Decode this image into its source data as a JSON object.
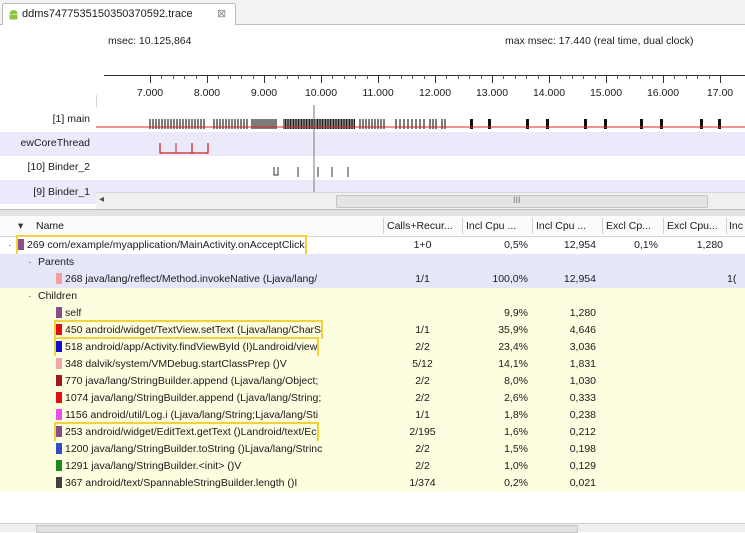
{
  "tab": {
    "title": "ddms7477535150350370592.trace",
    "close": "⊠"
  },
  "timeline": {
    "msec_label": "msec: 10.125,864",
    "max_label": "max msec: 17.440 (real time, dual clock)",
    "ticks": [
      "7.000",
      "8.000",
      "9.000",
      "10.000",
      "11.000",
      "12.000",
      "13.000",
      "14.000",
      "15.000",
      "16.000",
      "17.00"
    ],
    "threads": [
      "[1] main",
      "ewCoreThread",
      "[10] Binder_2",
      "[9] Binder_1"
    ],
    "scroll_left": "◂",
    "scroll_grip": "III"
  },
  "table": {
    "columns": [
      "Name",
      "Calls+Recur...",
      "Incl Cpu ...",
      "Incl Cpu ...",
      "Excl Cp...",
      "Excl Cpu...",
      "Inc"
    ],
    "sort_arrow": "▾",
    "rows": [
      {
        "id": "r0",
        "indent": 0,
        "expand": "·",
        "color": "#8a4d8a",
        "name": "269 com/example/myapplication/MainActivity.onAcceptClick",
        "calls": "1+0",
        "incl_pct": "0,5%",
        "incl": "12,954",
        "excl_pct": "0,1%",
        "excl": "1,280",
        "extra": "",
        "hl": true,
        "bg": "#ffffff"
      },
      {
        "id": "r1",
        "indent": 1,
        "expand": "·",
        "color": "",
        "name": "Parents",
        "calls": "",
        "incl_pct": "",
        "incl": "",
        "excl_pct": "",
        "excl": "",
        "extra": "",
        "hl": false,
        "bg": "#e6e6fa"
      },
      {
        "id": "r2",
        "indent": 2,
        "expand": "",
        "color": "#f2a0a0",
        "name": "268 java/lang/reflect/Method.invokeNative (Ljava/lang/",
        "calls": "1/1",
        "incl_pct": "100,0%",
        "incl": "12,954",
        "excl_pct": "",
        "excl": "",
        "extra": "1(",
        "hl": false,
        "bg": "#e6e6fa"
      },
      {
        "id": "r3",
        "indent": 1,
        "expand": "·",
        "color": "",
        "name": "Children",
        "calls": "",
        "incl_pct": "",
        "incl": "",
        "excl_pct": "",
        "excl": "",
        "extra": "",
        "hl": false,
        "bg": "#fdfde0"
      },
      {
        "id": "r4",
        "indent": 2,
        "expand": "",
        "color": "#8a4d8a",
        "name": "self",
        "calls": "",
        "incl_pct": "9,9%",
        "incl": "1,280",
        "excl_pct": "",
        "excl": "",
        "extra": "",
        "hl": false,
        "bg": "#fdfde0"
      },
      {
        "id": "r5",
        "indent": 2,
        "expand": "",
        "color": "#e01010",
        "name": "450 android/widget/TextView.setText (Ljava/lang/CharS",
        "calls": "1/1",
        "incl_pct": "35,9%",
        "incl": "4,646",
        "excl_pct": "",
        "excl": "",
        "extra": "",
        "hl": true,
        "bg": "#fdfde0"
      },
      {
        "id": "r6",
        "indent": 2,
        "expand": "",
        "color": "#1010c8",
        "name": "518 android/app/Activity.findViewById (I)Landroid/view",
        "calls": "2/2",
        "incl_pct": "23,4%",
        "incl": "3,036",
        "excl_pct": "",
        "excl": "",
        "extra": "",
        "hl": true,
        "bg": "#fdfde0"
      },
      {
        "id": "r7",
        "indent": 2,
        "expand": "",
        "color": "#f2a8a8",
        "name": "348 dalvik/system/VMDebug.startClassPrep ()V",
        "calls": "5/12",
        "incl_pct": "14,1%",
        "incl": "1,831",
        "excl_pct": "",
        "excl": "",
        "extra": "",
        "hl": false,
        "bg": "#fdfde0"
      },
      {
        "id": "r8",
        "indent": 2,
        "expand": "",
        "color": "#a01818",
        "name": "770 java/lang/StringBuilder.append (Ljava/lang/Object;",
        "calls": "2/2",
        "incl_pct": "8,0%",
        "incl": "1,030",
        "excl_pct": "",
        "excl": "",
        "extra": "",
        "hl": false,
        "bg": "#fdfde0"
      },
      {
        "id": "r9",
        "indent": 2,
        "expand": "",
        "color": "#e01010",
        "name": "1074 java/lang/StringBuilder.append (Ljava/lang/String;",
        "calls": "2/2",
        "incl_pct": "2,6%",
        "incl": "0,333",
        "excl_pct": "",
        "excl": "",
        "extra": "",
        "hl": false,
        "bg": "#fdfde0"
      },
      {
        "id": "r10",
        "indent": 2,
        "expand": "",
        "color": "#e850e8",
        "name": "1156 android/util/Log.i (Ljava/lang/String;Ljava/lang/Sti",
        "calls": "1/1",
        "incl_pct": "1,8%",
        "incl": "0,238",
        "excl_pct": "",
        "excl": "",
        "extra": "",
        "hl": false,
        "bg": "#fdfde0"
      },
      {
        "id": "r11",
        "indent": 2,
        "expand": "",
        "color": "#8a4d8a",
        "name": "253 android/widget/EditText.getText ()Landroid/text/Ec",
        "calls": "2/195",
        "incl_pct": "1,6%",
        "incl": "0,212",
        "excl_pct": "",
        "excl": "",
        "extra": "",
        "hl": true,
        "bg": "#fdfde0"
      },
      {
        "id": "r12",
        "indent": 2,
        "expand": "",
        "color": "#3050c0",
        "name": "1200 java/lang/StringBuilder.toString ()Ljava/lang/Strinc",
        "calls": "2/2",
        "incl_pct": "1,5%",
        "incl": "0,198",
        "excl_pct": "",
        "excl": "",
        "extra": "",
        "hl": false,
        "bg": "#fdfde0"
      },
      {
        "id": "r13",
        "indent": 2,
        "expand": "",
        "color": "#1a8a1a",
        "name": "1291 java/lang/StringBuilder.<init> ()V",
        "calls": "2/2",
        "incl_pct": "1,0%",
        "incl": "0,129",
        "excl_pct": "",
        "excl": "",
        "extra": "",
        "hl": false,
        "bg": "#fdfde0"
      },
      {
        "id": "r14",
        "indent": 2,
        "expand": "",
        "color": "#404040",
        "name": "367 android/text/SpannableStringBuilder.length ()I",
        "calls": "1/374",
        "incl_pct": "0,2%",
        "incl": "0,021",
        "excl_pct": "",
        "excl": "",
        "extra": "",
        "hl": false,
        "bg": "#fdfde0"
      }
    ]
  }
}
